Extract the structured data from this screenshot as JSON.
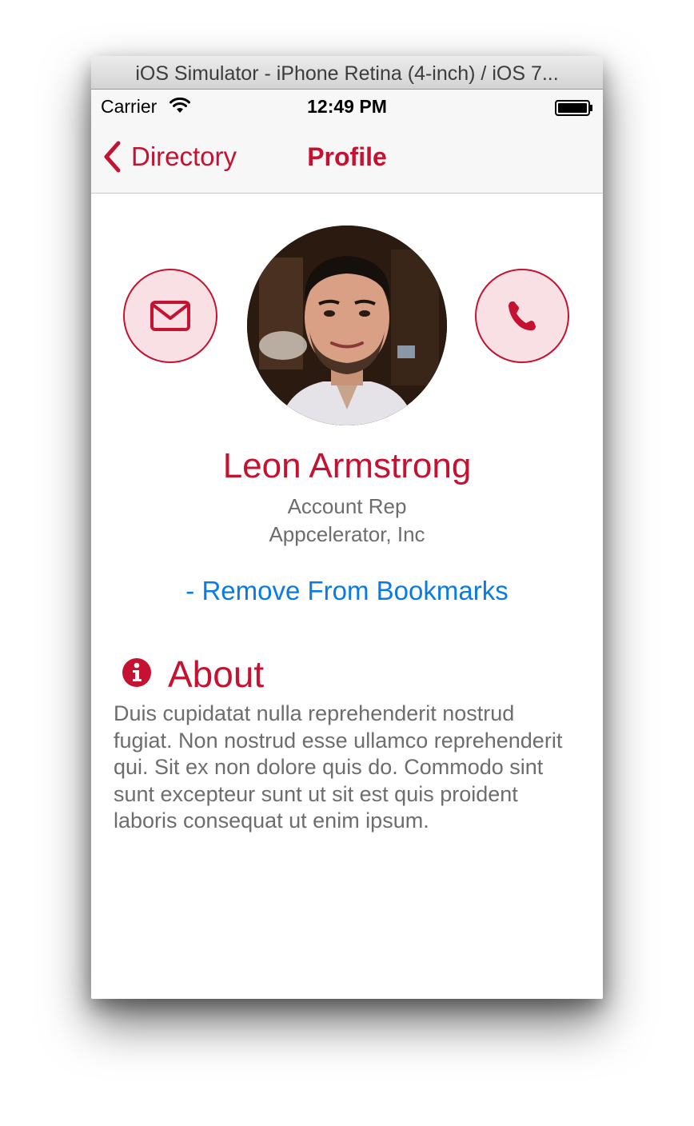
{
  "window": {
    "title": "iOS Simulator - iPhone Retina (4-inch) / iOS 7..."
  },
  "status_bar": {
    "carrier": "Carrier",
    "time": "12:49 PM",
    "wifi_icon": "wifi-icon",
    "battery_icon": "battery-icon"
  },
  "navbar": {
    "back_label": "Directory",
    "back_icon": "chevron-left-icon",
    "title": "Profile"
  },
  "profile": {
    "name": "Leon Armstrong",
    "role": "Account Rep",
    "company": "Appcelerator, Inc",
    "email_icon": "envelope-icon",
    "phone_icon": "phone-icon",
    "avatar_icon": "profile-photo"
  },
  "bookmark": {
    "label": "- Remove From Bookmarks"
  },
  "about": {
    "icon": "info-icon",
    "heading": "About",
    "body": "Duis cupidatat nulla reprehenderit nostrud fugiat. Non nostrud esse ullamco reprehenderit qui. Sit ex non dolore quis do. Commodo sint sunt excepteur sunt ut sit est quis proident laboris consequat ut enim ipsum."
  },
  "colors": {
    "accent": "#c41230",
    "accent_light": "#f9e0e4",
    "link": "#0a7ae9",
    "secondary_text": "#6d6d6d"
  }
}
